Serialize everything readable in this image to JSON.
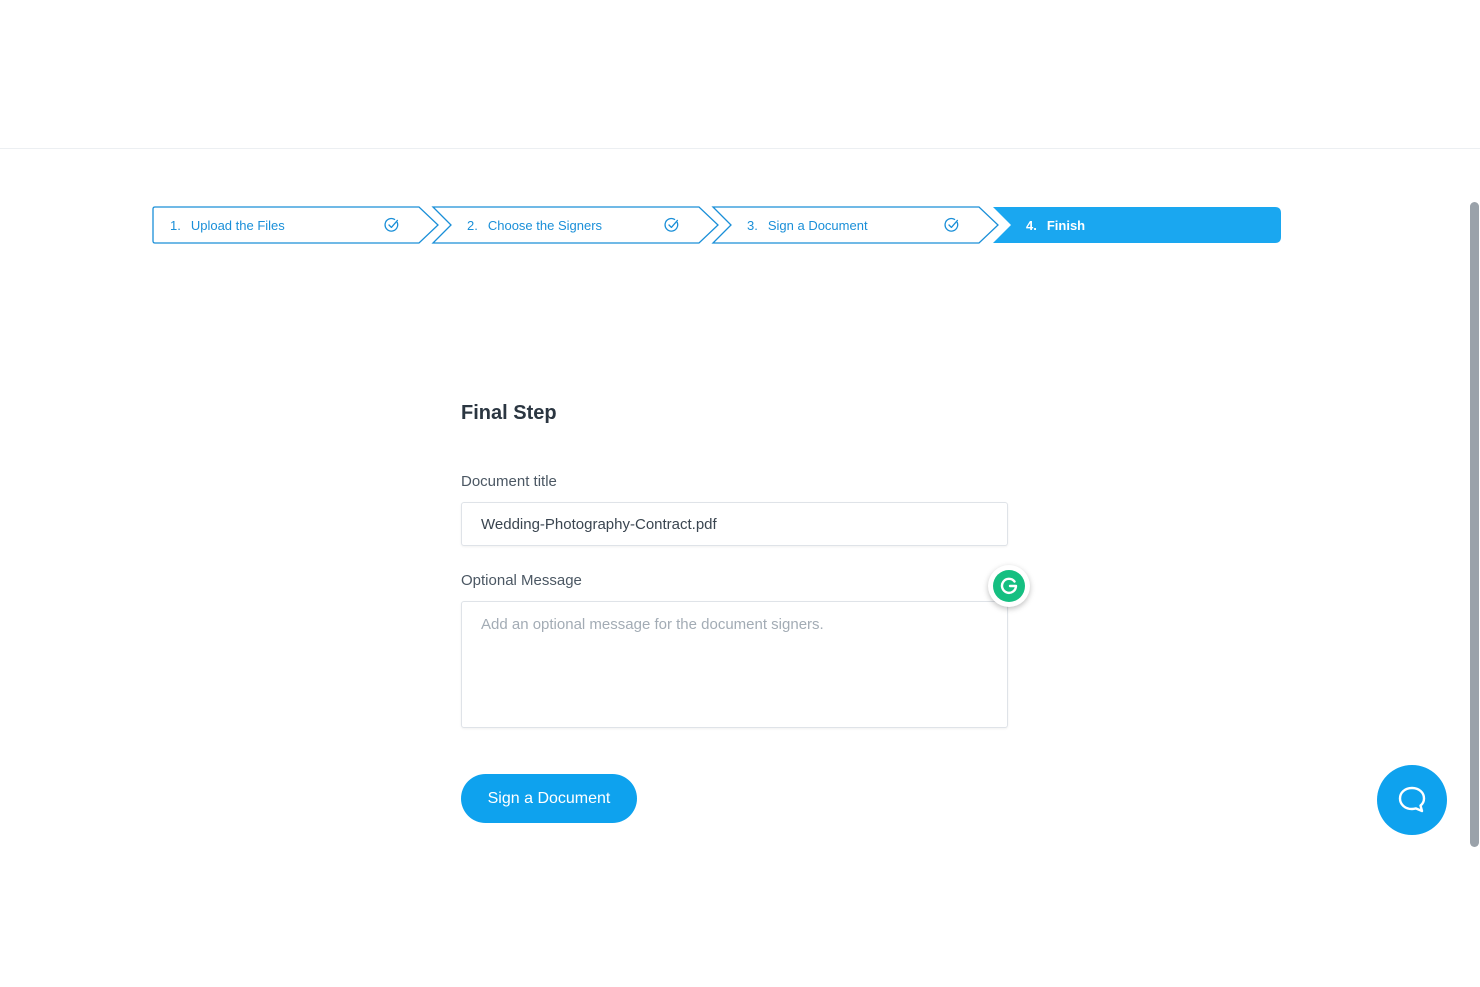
{
  "stepper": {
    "steps": [
      {
        "number": "1.",
        "label": "Upload the Files",
        "state": "completed"
      },
      {
        "number": "2.",
        "label": "Choose the Signers",
        "state": "completed"
      },
      {
        "number": "3.",
        "label": "Sign a Document",
        "state": "completed"
      },
      {
        "number": "4.",
        "label": "Finish",
        "state": "active"
      }
    ],
    "accent_color": "#1aa7f0",
    "outline_color": "#1a8fd8"
  },
  "form": {
    "heading": "Final Step",
    "document_title_label": "Document title",
    "document_title_value": "Wedding-Photography-Contract.pdf",
    "message_label": "Optional Message",
    "message_placeholder": "Add an optional message for the document signers.",
    "submit_label": "Sign a Document"
  },
  "widgets": {
    "grammarly_icon": "grammarly-icon",
    "chat_icon": "chat-bubble-icon",
    "brand_color": "#0ea2ee"
  }
}
